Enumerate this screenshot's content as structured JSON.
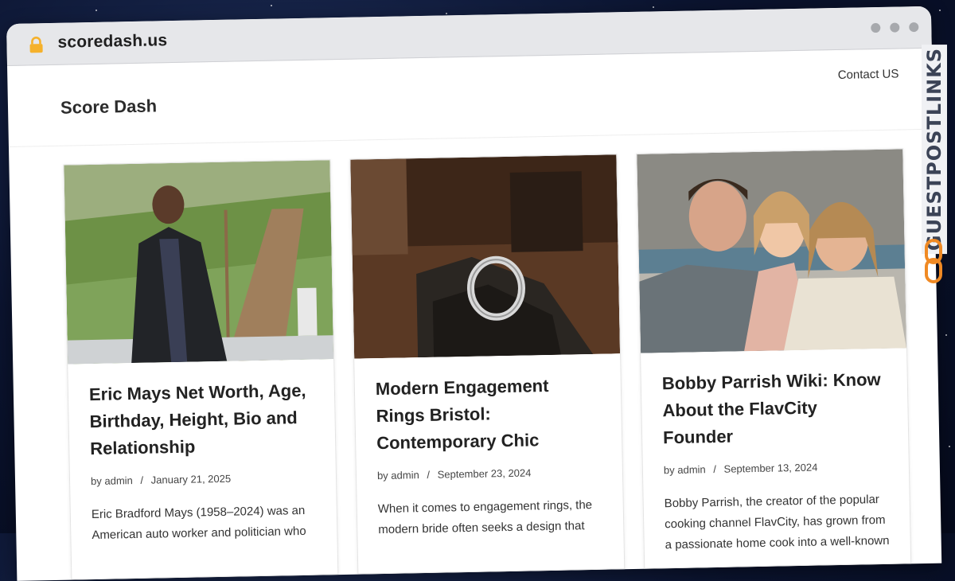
{
  "browser": {
    "url": "scoredash.us"
  },
  "site": {
    "title": "Score Dash",
    "nav": {
      "contact": "Contact US"
    }
  },
  "posts": [
    {
      "title": "Eric Mays Net Worth, Age, Birthday, Height, Bio and Relationship",
      "author_prefix": "by",
      "author": "admin",
      "separator": "/",
      "date": "January 21, 2025",
      "excerpt": "Eric Bradford Mays (1958–2024) was an American auto worker and politician who"
    },
    {
      "title": "Modern Engagement Rings Bristol: Contemporary Chic",
      "author_prefix": "by",
      "author": "admin",
      "separator": "/",
      "date": "September 23, 2024",
      "excerpt": "When it comes to engagement rings, the modern bride often seeks a design that"
    },
    {
      "title": "Bobby Parrish Wiki: Know About the FlavCity Founder",
      "author_prefix": "by",
      "author": "admin",
      "separator": "/",
      "date": "September 13, 2024",
      "excerpt": "Bobby Parrish, the creator of the popular cooking channel FlavCity, has grown from a passionate home cook into a well-known"
    }
  ],
  "watermark": {
    "text": "GUESTPOSTLINKS"
  },
  "colors": {
    "accent": "#f08a24",
    "lock": "#f5b12b"
  }
}
